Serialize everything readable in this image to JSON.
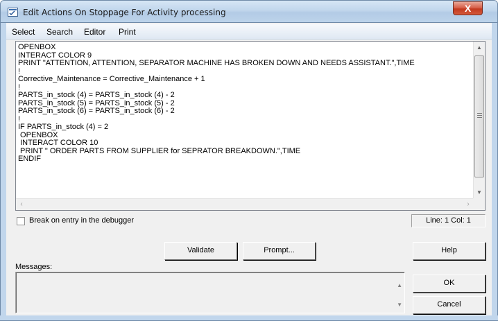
{
  "window": {
    "title": "Edit Actions On Stoppage For Activity processing",
    "close_label": "X"
  },
  "menu": {
    "items": [
      "Select",
      "Search",
      "Editor",
      "Print"
    ]
  },
  "editor": {
    "lines": [
      "OPENBOX",
      "INTERACT COLOR 9",
      "PRINT \"ATTENTION, ATTENTION, SEPARATOR MACHINE HAS BROKEN DOWN AND NEEDS ASSISTANT.\",TIME",
      "!",
      "Corrective_Maintenance = Corrective_Maintenance + 1",
      "!",
      "PARTS_in_stock (4) = PARTS_in_stock (4) - 2",
      "PARTS_in_stock (5) = PARTS_in_stock (5) - 2",
      "PARTS_in_stock (6) = PARTS_in_stock (6) - 2",
      "!",
      "IF PARTS_in_stock (4) = 2",
      " OPENBOX",
      " INTERACT COLOR 10",
      " PRINT \" ORDER PARTS FROM SUPPLIER for SEPRATOR BREAKDOWN.\",TIME",
      "ENDIF"
    ]
  },
  "debug": {
    "checkbox_label": "Break on entry in the debugger",
    "checked": false,
    "line_col": "Line: 1 Col: 1"
  },
  "buttons": {
    "validate": "Validate",
    "prompt": "Prompt...",
    "help": "Help",
    "ok": "OK",
    "cancel": "Cancel"
  },
  "messages": {
    "label": "Messages:",
    "text": ""
  },
  "colors": {
    "titlebar": "#c1d6ec",
    "close_button": "#c3391f",
    "dialog_background": "#f0f0f0"
  },
  "icons": [
    "app-window-icon",
    "close-icon",
    "scroll-up-icon",
    "scroll-down-icon",
    "scroll-left-icon",
    "scroll-right-icon"
  ]
}
